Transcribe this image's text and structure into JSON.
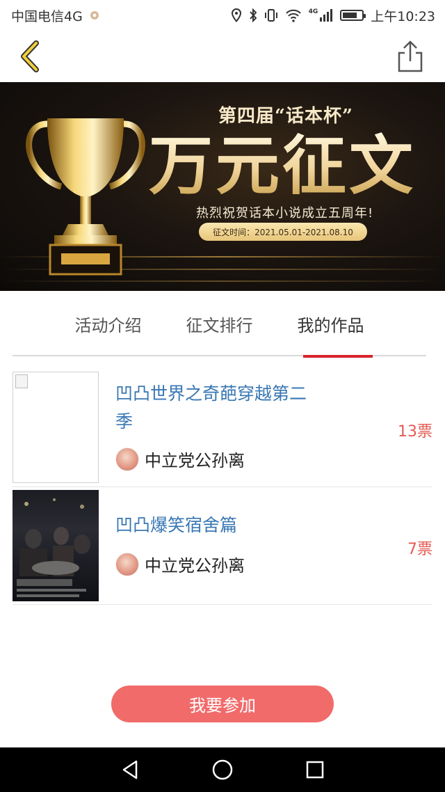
{
  "status_bar": {
    "carrier": "中国电信4G",
    "time": "上午10:23",
    "network_badge": "4G",
    "battery_level": 0.75,
    "icons": [
      "location-icon",
      "bluetooth-icon",
      "vibrate-icon",
      "wifi-icon",
      "signal-icon",
      "battery-icon"
    ]
  },
  "header": {
    "back_icon": "chevron-left-icon",
    "share_icon": "share-icon"
  },
  "banner": {
    "title_small": "第四届“话本杯”",
    "title_big": "万元征文",
    "subtitle": "热烈祝贺话本小说成立五周年!",
    "date_text": "征文时间：2021.05.01-2021.08.10"
  },
  "tabs": [
    {
      "label": "活动介绍",
      "active": false
    },
    {
      "label": "征文排行",
      "active": false
    },
    {
      "label": "我的作品",
      "active": true
    }
  ],
  "works": [
    {
      "title": "凹凸世界之奇葩穿越第二季",
      "author": "中立党公孙离",
      "votes": "13票"
    },
    {
      "title": "凹凸爆笑宿舍篇",
      "author": "中立党公孙离",
      "votes": "7票"
    }
  ],
  "join_button": {
    "label": "我要参加"
  },
  "colors": {
    "accent_red": "#d8232a",
    "title_blue": "#3877b3",
    "votes_red": "#e45a52",
    "button_red": "#f16b6b"
  },
  "nav_bar": {
    "icons": [
      "back-triangle-icon",
      "home-circle-icon",
      "recents-square-icon"
    ]
  }
}
